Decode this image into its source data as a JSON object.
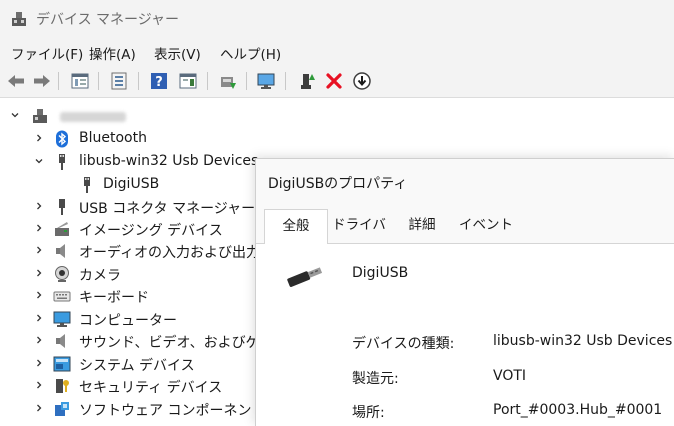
{
  "window": {
    "title": "デバイス マネージャー"
  },
  "menu": [
    "ファイル(F)",
    "操作(A)",
    "表示(V)",
    "ヘルプ(H)"
  ],
  "toolbar": [
    "back-arrow-icon",
    "forward-arrow-icon",
    "properties-icon",
    "list-icon",
    "help-icon",
    "view-icon",
    "scan-hardware-icon",
    "monitor-icon",
    "enable-device-icon",
    "uninstall-x-icon",
    "update-driver-icon"
  ],
  "tree": {
    "items": [
      "Bluetooth",
      "libusb-win32 Usb Devices",
      "DigiUSB",
      "USB コネクタ マネージャー",
      "イメージング デバイス",
      "オーディオの入力および出力",
      "カメラ",
      "キーボード",
      "コンピューター",
      "サウンド、ビデオ、およびゲーム コ",
      "システム デバイス",
      "セキュリティ デバイス",
      "ソフトウェア コンポーネント"
    ]
  },
  "dialog": {
    "title": "DigiUSBのプロパティ",
    "tabs": [
      "全般",
      "ドライバー",
      "詳細",
      "イベント"
    ],
    "device_name": "DigiUSB",
    "fields": [
      {
        "label": "デバイスの種類:",
        "value": "libusb-win32 Usb Devices"
      },
      {
        "label": "製造元:",
        "value": "VOTI"
      },
      {
        "label": "場所:",
        "value": "Port_#0003.Hub_#0001"
      }
    ]
  },
  "colors": {
    "bluetooth": "#1e6fd9",
    "uninstall": "#e81123",
    "accent": "#0067c0"
  }
}
